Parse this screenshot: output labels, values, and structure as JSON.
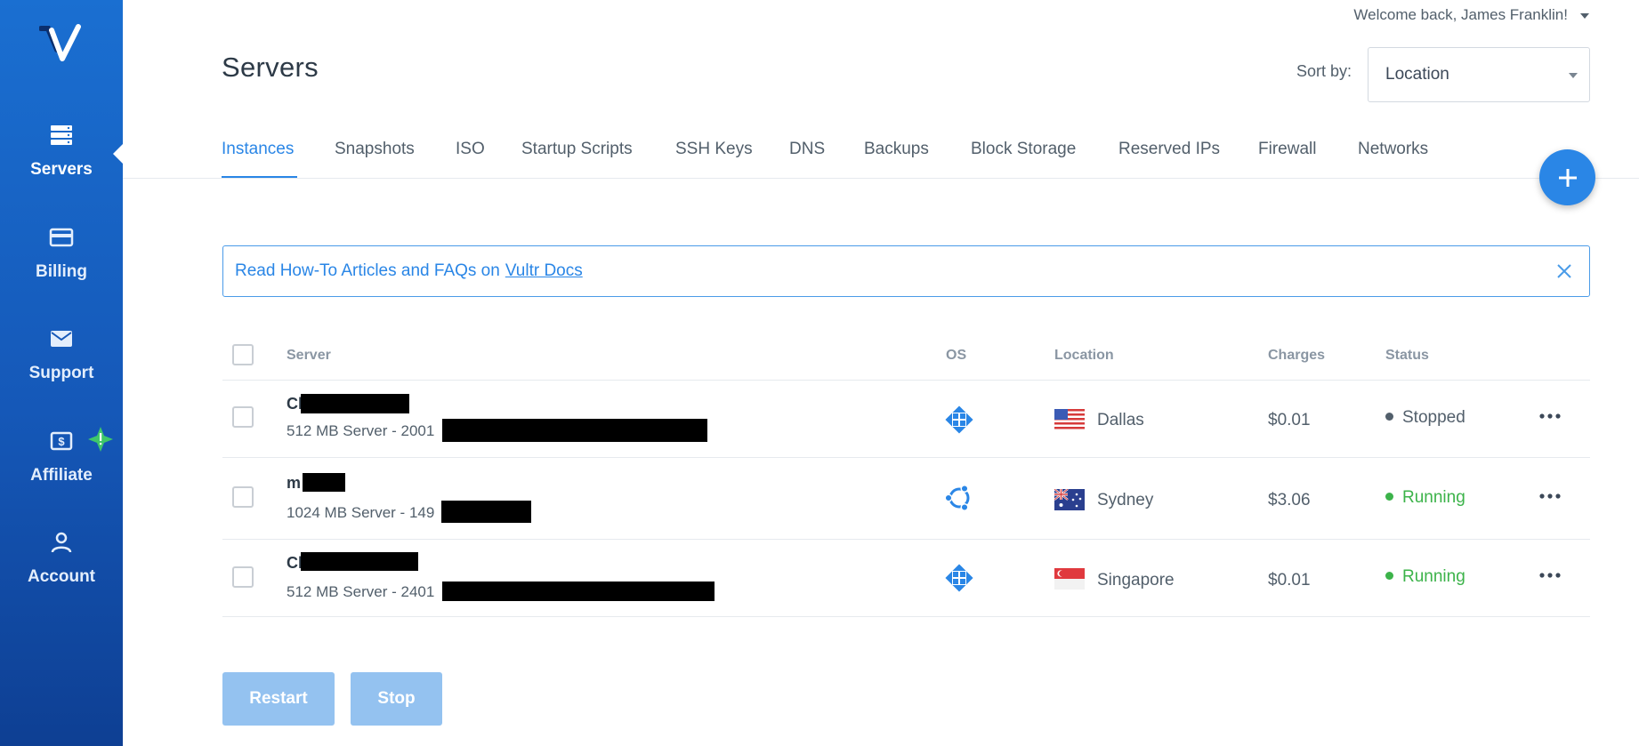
{
  "sidebar": {
    "logo": "vultr-logo",
    "items": [
      {
        "label": "Servers",
        "icon": "servers-icon",
        "active": true
      },
      {
        "label": "Billing",
        "icon": "credit-card-icon"
      },
      {
        "label": "Support",
        "icon": "envelope-icon"
      },
      {
        "label": "Affiliate",
        "icon": "dollar-icon",
        "badge": "notification-icon"
      },
      {
        "label": "Account",
        "icon": "user-icon"
      }
    ]
  },
  "header": {
    "welcome": "Welcome back, James Franklin!",
    "title": "Servers",
    "sort_label": "Sort by:",
    "sort_value": "Location"
  },
  "tabs": [
    "Instances",
    "Snapshots",
    "ISO",
    "Startup Scripts",
    "SSH Keys",
    "DNS",
    "Backups",
    "Block Storage",
    "Reserved IPs",
    "Firewall",
    "Networks"
  ],
  "active_tab": "Instances",
  "banner": {
    "text": "Read How-To Articles and FAQs on",
    "link": "Vultr Docs"
  },
  "table": {
    "headers": {
      "server": "Server",
      "os": "OS",
      "location": "Location",
      "charges": "Charges",
      "status": "Status"
    },
    "rows": [
      {
        "name": "Cl",
        "desc": "512 MB Server - 2001",
        "os": "centos-icon",
        "location": "Dallas",
        "flag": "us-flag",
        "charges": "$0.01",
        "status": "Stopped"
      },
      {
        "name": "m",
        "desc": "1024 MB Server - 149",
        "os": "ubuntu-icon",
        "location": "Sydney",
        "flag": "au-flag",
        "charges": "$3.06",
        "status": "Running"
      },
      {
        "name": "Cl",
        "desc": "512 MB Server - 2401",
        "os": "centos-icon",
        "location": "Singapore",
        "flag": "sg-flag",
        "charges": "$0.01",
        "status": "Running"
      }
    ]
  },
  "buttons": {
    "restart": "Restart",
    "stop": "Stop"
  },
  "colors": {
    "accent": "#2a86e6",
    "running": "#3cb34a",
    "sidebar": "#1558b8"
  }
}
